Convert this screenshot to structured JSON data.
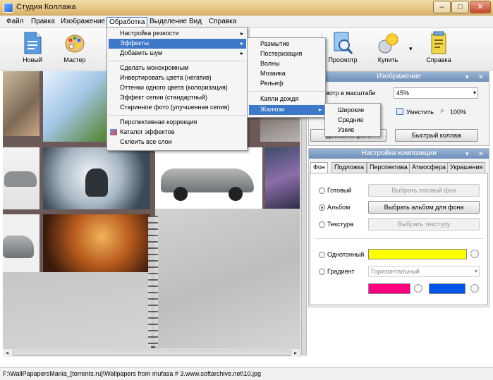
{
  "window": {
    "title": "Студия Коллажа",
    "controls": {
      "min": "–",
      "max": "□",
      "close": "✕"
    }
  },
  "menubar": {
    "items": [
      "Файл",
      "Правка",
      "Изображение",
      "Обработка",
      "Выделение",
      "Вид",
      "Справка"
    ],
    "active_index": 3
  },
  "toolbar": {
    "tools": [
      {
        "label": "Новый",
        "icon": "new-document-icon"
      },
      {
        "label": "Мастер",
        "icon": "palette-icon"
      },
      {
        "label": "Просмотр",
        "icon": "preview-icon"
      },
      {
        "label": "Купить",
        "icon": "buy-icon"
      },
      {
        "label": "Справка",
        "icon": "help-icon"
      }
    ]
  },
  "processing_menu": {
    "items": [
      {
        "label": "Настройка резкости",
        "submenu": true
      },
      {
        "label": "Эффекты",
        "submenu": true,
        "highlighted": true
      },
      {
        "label": "Добавить шум",
        "submenu": true
      },
      {
        "separator": true
      },
      {
        "label": "Сделать монохромным"
      },
      {
        "label": "Инвертировать цвета (негатив)"
      },
      {
        "label": "Оттенки одного цвета (колоризация)"
      },
      {
        "label": "Эффект сепии (стандартный)"
      },
      {
        "label": "Старинное фото (улучшенная сепия)"
      },
      {
        "separator": true
      },
      {
        "label": "Перспективная коррекция"
      },
      {
        "label": "Каталог эффектов",
        "icon": "effects-catalog-icon"
      },
      {
        "label": "Склеить все слои"
      }
    ]
  },
  "effects_menu": {
    "items": [
      {
        "label": "Размытие"
      },
      {
        "label": "Постеризация"
      },
      {
        "label": "Волны"
      },
      {
        "label": "Мозаика"
      },
      {
        "label": "Рельеф"
      },
      {
        "separator": true
      },
      {
        "label": "Капли дождя"
      },
      {
        "label": "Жалюзи",
        "submenu": true,
        "highlighted": true
      }
    ]
  },
  "blinds_menu": {
    "items": [
      "Широкие",
      "Средние",
      "Узкие"
    ]
  },
  "image_panel": {
    "title": "Изображение",
    "scale_label": "смотр в масштабе",
    "scale_value": "45%",
    "fit_label": "Уместить",
    "zoom_label": "100%",
    "add_photo_label": "Добавить фото",
    "quick_collage_label": "Быстрый коллаж"
  },
  "composition_panel": {
    "title": "Настройка композиции",
    "tabs": [
      "Фон",
      "Подложка",
      "Перспектива",
      "Атмосфера",
      "Украшения"
    ],
    "active_tab": 0,
    "options": [
      {
        "label": "Готовый",
        "button": "Выбрать готовый фон",
        "selected": false,
        "enabled": false
      },
      {
        "label": "Альбом",
        "button": "Выбрать альбом для фона",
        "selected": true,
        "enabled": true
      },
      {
        "label": "Текстура",
        "button": "Выбрать текстуру",
        "selected": false,
        "enabled": false
      }
    ],
    "solid_label": "Однотонный",
    "solid_color": "#ffff00",
    "gradient_label": "Градиент",
    "gradient_type": "Горизонтальный",
    "gradient_color1": "#ff007f",
    "gradient_color2": "#0055e6"
  },
  "statusbar": {
    "path": "F:\\WallPapapersMania_[torrents.ru]\\Wallpapers from mufasa # 3.www.softarchive.net\\10.jpg"
  }
}
